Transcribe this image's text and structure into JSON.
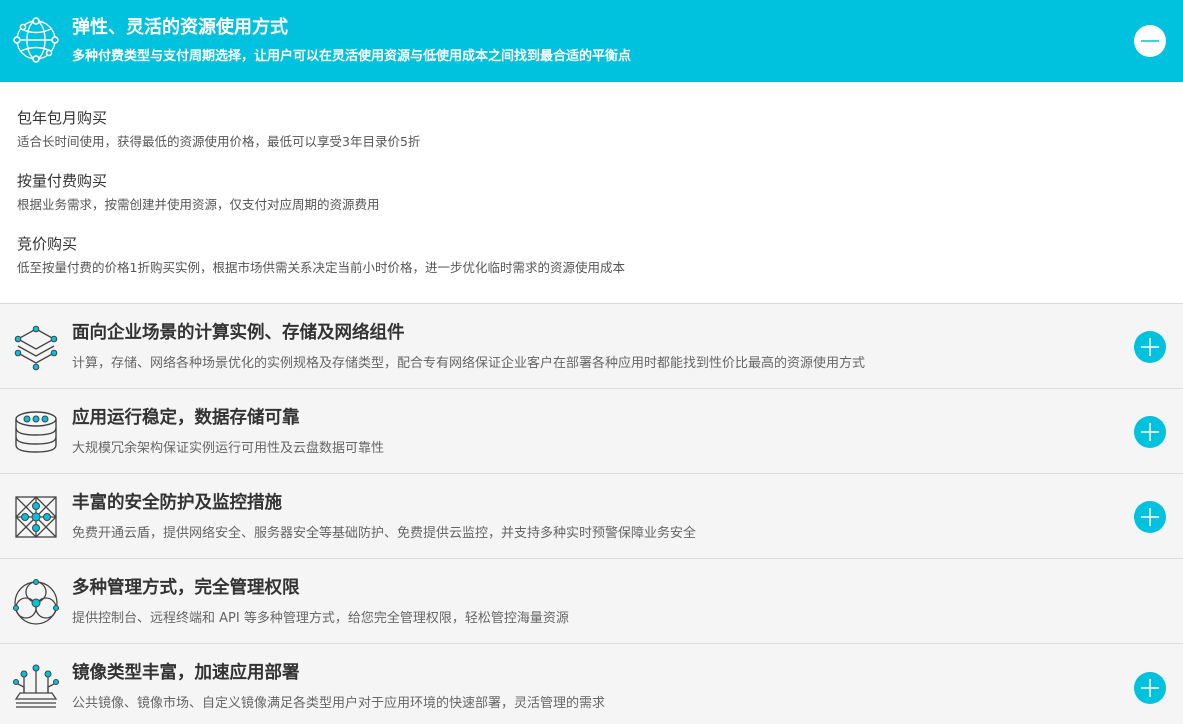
{
  "colors": {
    "accent": "#00c1de"
  },
  "header": {
    "title": "弹性、灵活的资源使用方式",
    "description": "多种付费类型与支付周期选择，让用户可以在灵活使用资源与低使用成本之间找到最合适的平衡点",
    "icon": "globe-network-icon",
    "toggle": "collapse-icon"
  },
  "options": [
    {
      "title": "包年包月购买",
      "description": "适合长时间使用，获得最低的资源使用价格，最低可以享受3年目录价5折"
    },
    {
      "title": "按量付费购买",
      "description": "根据业务需求，按需创建并使用资源，仅支付对应周期的资源费用"
    },
    {
      "title": "竞价购买",
      "description": "低至按量付费的价格1折购买实例，根据市场供需关系决定当前小时价格，进一步优化临时需求的资源使用成本"
    }
  ],
  "rows": [
    {
      "title": "面向企业场景的计算实例、存储及网络组件",
      "description": "计算，存储、网络各种场景优化的实例规格及存储类型，配合专有网络保证企业客户在部署各种应用时都能找到性价比最高的资源使用方式",
      "icon": "layers-icon",
      "has_toggle": true
    },
    {
      "title": "应用运行稳定，数据存储可靠",
      "description": "大规模冗余架构保证实例运行可用性及云盘数据可靠性",
      "icon": "database-icon",
      "has_toggle": true
    },
    {
      "title": "丰富的安全防护及监控措施",
      "description": "免费开通云盾，提供网络安全、服务器安全等基础防护、免费提供云监控，并支持多种实时预警保障业务安全",
      "icon": "security-network-icon",
      "has_toggle": true
    },
    {
      "title": "多种管理方式，完全管理权限",
      "description": "提供控制台、远程终端和 API 等多种管理方式，给您完全管理权限，轻松管控海量资源",
      "icon": "management-rings-icon",
      "has_toggle": false
    },
    {
      "title": "镜像类型丰富，加速应用部署",
      "description": "公共镜像、镜像市场、自定义镜像满足各类型用户对于应用环境的快速部署，灵活管理的需求",
      "icon": "image-deploy-icon",
      "has_toggle": true
    }
  ]
}
